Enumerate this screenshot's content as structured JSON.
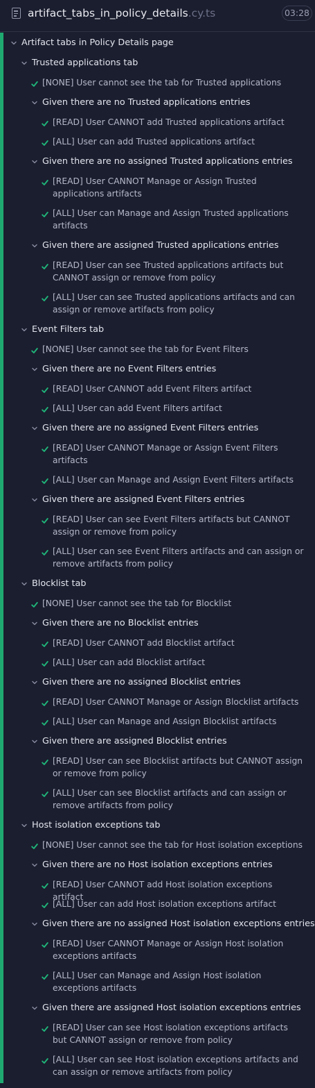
{
  "header": {
    "file_name": "artifact_tabs_in_policy_details",
    "file_ext": ".cy.ts",
    "duration": "03:28"
  },
  "colors": {
    "pass": "#1fa971",
    "background": "#1b1e2e"
  },
  "tree": {
    "root": "Artifact tabs in Policy Details page",
    "ta_tab": "Trusted applications tab",
    "ta_none": "[NONE] User cannot see the tab for Trusted applications",
    "ta_g1": "Given there are no Trusted applications entries",
    "ta_g1_read": "[READ] User CANNOT add Trusted applications artifact",
    "ta_g1_all": "[ALL] User can add Trusted applications artifact",
    "ta_g2": "Given there are no assigned Trusted applications entries",
    "ta_g2_read": "[READ] User CANNOT Manage or Assign Trusted applications artifacts",
    "ta_g2_all": "[ALL] User can Manage and Assign Trusted applications artifacts",
    "ta_g3": "Given there are assigned Trusted applications entries",
    "ta_g3_read": "[READ] User can see Trusted applications artifacts but CANNOT assign or remove from policy",
    "ta_g3_all": "[ALL] User can see Trusted applications artifacts and can assign or remove artifacts from policy",
    "ef_tab": "Event Filters tab",
    "ef_none": "[NONE] User cannot see the tab for Event Filters",
    "ef_g1": "Given there are no Event Filters entries",
    "ef_g1_read": "[READ] User CANNOT add Event Filters artifact",
    "ef_g1_all": "[ALL] User can add Event Filters artifact",
    "ef_g2": "Given there are no assigned Event Filters entries",
    "ef_g2_read": "[READ] User CANNOT Manage or Assign Event Filters artifacts",
    "ef_g2_all": "[ALL] User can Manage and Assign Event Filters artifacts",
    "ef_g3": "Given there are assigned Event Filters entries",
    "ef_g3_read": "[READ] User can see Event Filters artifacts but CANNOT assign or remove from policy",
    "ef_g3_all": "[ALL] User can see Event Filters artifacts and can assign or remove artifacts from policy",
    "bl_tab": "Blocklist tab",
    "bl_none": "[NONE] User cannot see the tab for Blocklist",
    "bl_g1": "Given there are no Blocklist entries",
    "bl_g1_read": "[READ] User CANNOT add Blocklist artifact",
    "bl_g1_all": "[ALL] User can add Blocklist artifact",
    "bl_g2": "Given there are no assigned Blocklist entries",
    "bl_g2_read": "[READ] User CANNOT Manage or Assign Blocklist artifacts",
    "bl_g2_all": "[ALL] User can Manage and Assign Blocklist artifacts",
    "bl_g3": "Given there are assigned Blocklist entries",
    "bl_g3_read": "[READ] User can see Blocklist artifacts but CANNOT assign or remove from policy",
    "bl_g3_all": "[ALL] User can see Blocklist artifacts and can assign or remove artifacts from policy",
    "hi_tab": "Host isolation exceptions tab",
    "hi_none": "[NONE] User cannot see the tab for Host isolation exceptions",
    "hi_g1": "Given there are no Host isolation exceptions entries",
    "hi_g1_read": "[READ] User CANNOT add Host isolation exceptions artifact",
    "hi_g1_all": "[ALL] User can add Host isolation exceptions artifact",
    "hi_g2": "Given there are no assigned Host isolation exceptions entries",
    "hi_g2_read": "[READ] User CANNOT Manage or Assign Host isolation exceptions artifacts",
    "hi_g2_all": "[ALL] User can Manage and Assign Host isolation exceptions artifacts",
    "hi_g3": "Given there are assigned Host isolation exceptions entries",
    "hi_g3_read": "[READ] User can see Host isolation exceptions artifacts but CANNOT assign or remove from policy",
    "hi_g3_all": "[ALL] User can see Host isolation exceptions artifacts and can assign or remove artifacts from policy"
  }
}
